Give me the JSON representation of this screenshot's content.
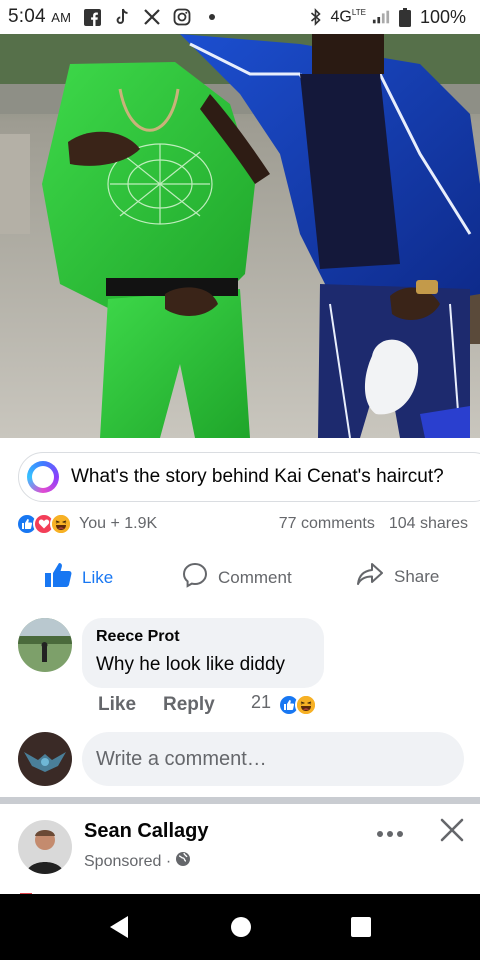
{
  "status_bar": {
    "time": "5:04",
    "ampm": "AM",
    "network": "4G",
    "network_sup": "LTE",
    "battery": "100%",
    "icons": [
      "facebook-icon",
      "tiktok-icon",
      "x-icon",
      "instagram-icon",
      "dot-icon",
      "bluetooth-icon",
      "signal-icon",
      "battery-icon"
    ]
  },
  "post": {
    "photo_icon": "photo-two-men-tracksuits",
    "ai_prompt": "What's the story behind Kai Cenat's haircut?",
    "reactions_text": "You + 1.9K",
    "comments_count": "77 comments",
    "shares_count": "104 shares",
    "actions": {
      "like": "Like",
      "comment": "Comment",
      "share": "Share"
    }
  },
  "comment": {
    "author": "Reece Prot",
    "text": "Why he look like diddy",
    "like_label": "Like",
    "reply_label": "Reply",
    "reaction_count": "21"
  },
  "write_comment": {
    "placeholder": "Write a comment…"
  },
  "sponsored": {
    "name": "Sean Callagy",
    "sub": "Sponsored ·"
  },
  "colors": {
    "fb_blue": "#1877f2",
    "text_secondary": "#65676b",
    "bubble_bg": "#f0f2f5"
  }
}
